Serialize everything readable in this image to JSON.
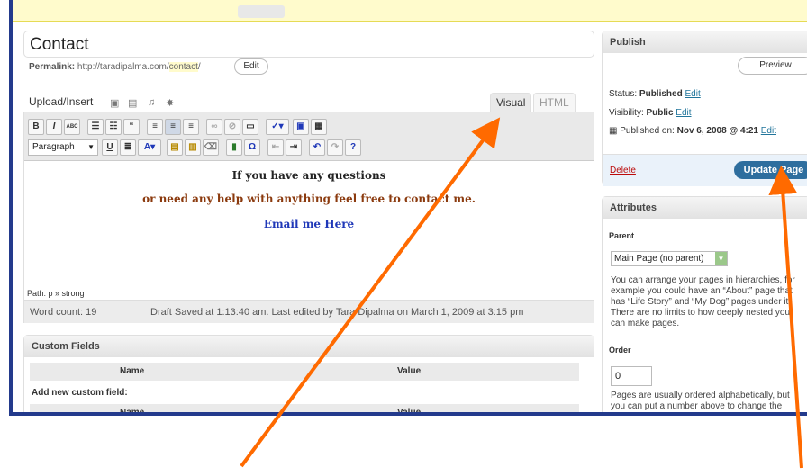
{
  "post": {
    "title": "Contact",
    "permalink_label": "Permalink:",
    "permalink_base": "http://taradipalma.com/",
    "permalink_slug": "contact",
    "permalink_tail": "/",
    "edit_label": "Edit"
  },
  "media": {
    "upload_label": "Upload/Insert"
  },
  "tabs": {
    "visual": "Visual",
    "html": "HTML"
  },
  "toolbar": {
    "bold": "B",
    "italic": "I",
    "strike": "ABC",
    "quote": "“",
    "format_select": "Paragraph",
    "underline": "U",
    "color": "A",
    "omega": "Ω"
  },
  "content": {
    "line1": "If you have any questions",
    "line2": "or need any help with anything feel free to contact me.",
    "line3": "Email me Here"
  },
  "status": {
    "path": "Path: p » strong",
    "word_count": "Word count: 19",
    "draft_saved": "Draft Saved at 1:13:40 am. Last edited by Tara Dipalma on March 1, 2009 at 3:15 pm"
  },
  "custom_fields": {
    "heading": "Custom Fields",
    "col_name": "Name",
    "col_value": "Value",
    "add_new": "Add new custom field:"
  },
  "publish": {
    "heading": "Publish",
    "preview": "Preview",
    "status_label": "Status:",
    "status_value": "Published",
    "visibility_label": "Visibility:",
    "visibility_value": "Public",
    "published_label": "Published on:",
    "published_value": "Nov 6, 2008 @ 4:21",
    "edit": "Edit",
    "delete": "Delete",
    "update": "Update Page"
  },
  "attributes": {
    "heading": "Attributes",
    "parent_label": "Parent",
    "parent_value": "Main Page (no parent)",
    "parent_help": "You can arrange your pages in hierarchies, for example you could have an “About” page that has “Life Story” and “My Dog” pages under it. There are no limits to how deeply nested you can make pages.",
    "order_label": "Order",
    "order_value": "0",
    "order_help": "Pages are usually ordered alphabetically, but you can put a number above to change the order pages appear in. (We know this is a little janky, it'll be better in future"
  },
  "colors": {
    "annotation_arrow": "#ff6a00",
    "frame_border": "#233a8c",
    "update_button": "#2e6e9e"
  }
}
